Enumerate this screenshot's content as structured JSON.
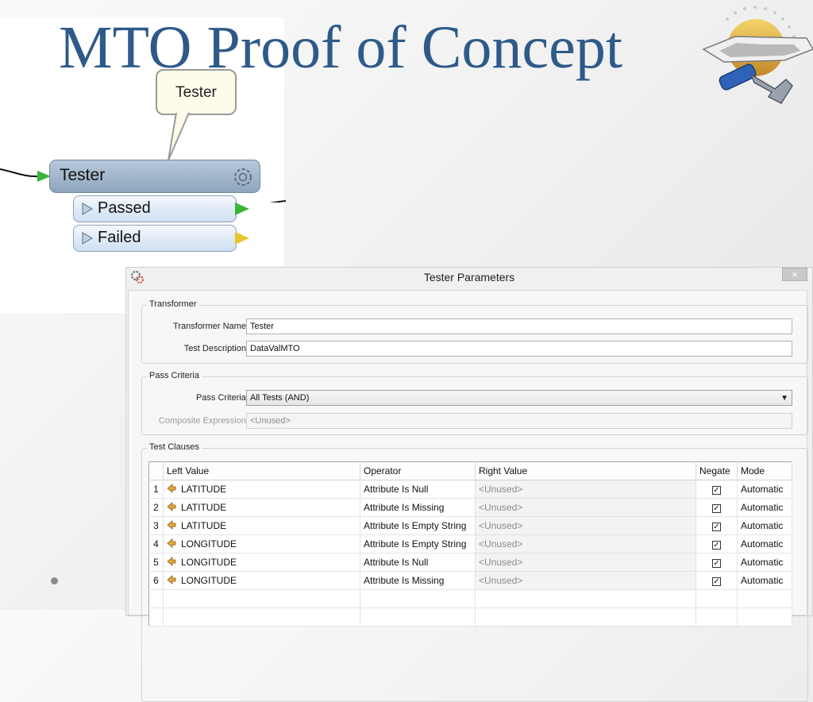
{
  "slide": {
    "title": "MTO Proof of Concept"
  },
  "workflow": {
    "callout_text": "Tester",
    "transformer_label": "Tester",
    "ports": [
      {
        "label": "Passed",
        "color": "#3ab53a"
      },
      {
        "label": "Failed",
        "color": "#e6c52e"
      }
    ]
  },
  "dialog": {
    "title": "Tester Parameters",
    "close_label": "×",
    "transformer_group": {
      "legend": "Transformer",
      "name_label": "Transformer Name:",
      "name_value": "Tester",
      "desc_label": "Test Description:",
      "desc_value": "DataValMTO"
    },
    "pass_group": {
      "legend": "Pass Criteria",
      "criteria_label": "Pass Criteria:",
      "criteria_value": "All Tests (AND)",
      "composite_label": "Composite Expression:",
      "composite_value": "<Unused>"
    },
    "tests_group": {
      "legend": "Test Clauses",
      "columns": [
        "Left Value",
        "Operator",
        "Right Value",
        "Negate",
        "Mode"
      ],
      "rows": [
        {
          "num": "1",
          "left": "LATITUDE",
          "op": "Attribute Is Null",
          "right": "<Unused>",
          "negate": true,
          "mode": "Automatic"
        },
        {
          "num": "2",
          "left": "LATITUDE",
          "op": "Attribute Is Missing",
          "right": "<Unused>",
          "negate": true,
          "mode": "Automatic"
        },
        {
          "num": "3",
          "left": "LATITUDE",
          "op": "Attribute Is Empty String",
          "right": "<Unused>",
          "negate": true,
          "mode": "Automatic"
        },
        {
          "num": "4",
          "left": "LONGITUDE",
          "op": "Attribute Is Empty String",
          "right": "<Unused>",
          "negate": true,
          "mode": "Automatic"
        },
        {
          "num": "5",
          "left": "LONGITUDE",
          "op": "Attribute Is Null",
          "right": "<Unused>",
          "negate": true,
          "mode": "Automatic"
        },
        {
          "num": "6",
          "left": "LONGITUDE",
          "op": "Attribute Is Missing",
          "right": "<Unused>",
          "negate": true,
          "mode": "Automatic"
        }
      ]
    }
  }
}
